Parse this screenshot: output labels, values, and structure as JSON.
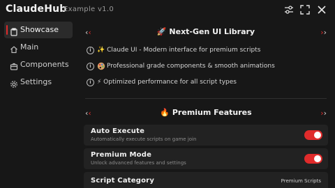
{
  "window": {
    "app_name": "ClaudeHub",
    "version_label": "Example v1.0",
    "icons": [
      "sliders-icon",
      "fullscreen-icon",
      "close-icon"
    ]
  },
  "sidebar": {
    "items": [
      {
        "label": "Showcase",
        "icon": "clipboard-icon",
        "active": true
      },
      {
        "label": "Main",
        "icon": "home-icon",
        "active": false
      },
      {
        "label": "Components",
        "icon": "box-icon",
        "active": false
      },
      {
        "label": "Settings",
        "icon": "gear-icon",
        "active": false
      }
    ]
  },
  "showcase": {
    "library_section": {
      "title": "🚀 Next-Gen UI Library",
      "features": [
        {
          "emoji": "sparkles-icon",
          "text": "✨ Claude UI - Modern interface for premium scripts"
        },
        {
          "emoji": "palette-icon",
          "text": "Professional grade components & smooth animations"
        },
        {
          "emoji": "lightning-icon",
          "text": "⚡ Optimized performance for all script types"
        }
      ]
    },
    "premium_section": {
      "title": "🔥 Premium Features",
      "toggles": [
        {
          "title": "Auto Execute",
          "description": "Automatically execute scripts on game join",
          "enabled": true
        },
        {
          "title": "Premium Mode",
          "description": "Unlock advanced features and settings",
          "enabled": true
        }
      ],
      "dropdown": {
        "title": "Script Category",
        "value": "Premium Scripts"
      }
    }
  },
  "colors": {
    "accent": "#e02b2b",
    "background": "#171717",
    "card": "#222222",
    "active_nav": "#2b2b2b"
  }
}
